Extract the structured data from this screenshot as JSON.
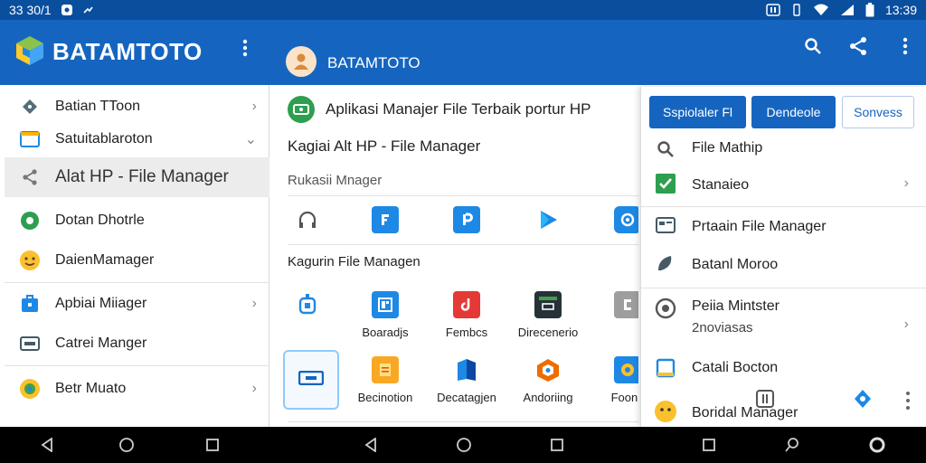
{
  "status_bar": {
    "time_left": "33 30/1",
    "time_right": "13:39"
  },
  "app_bar": {
    "title": "BATAMTOTO",
    "subtitle_title": "BATAMTOTO"
  },
  "drawer": {
    "items": [
      {
        "label": "Batian TToon",
        "icon": "diamond-tag-icon",
        "chevron": "›"
      },
      {
        "label": "Satuitablaroton",
        "icon": "calendar-window-icon",
        "chevron": "⌄"
      },
      {
        "label": "Alat HP - File Manager",
        "icon": "share-icon",
        "chevron": ""
      },
      {
        "label": "Dotan Dhotrle",
        "icon": "green-circle-icon",
        "chevron": ""
      },
      {
        "label": "DaienMamager",
        "icon": "smiley-icon",
        "chevron": ""
      },
      {
        "label": "Apbiai Miiager",
        "icon": "briefcase-icon",
        "chevron": "›"
      },
      {
        "label": "Catrei Manger",
        "icon": "card-icon",
        "chevron": ""
      },
      {
        "label": "Betr Muato",
        "icon": "globe-icon",
        "chevron": "›"
      }
    ]
  },
  "main": {
    "heading": "Aplikasi Manajer File Terbaik portur HP",
    "subtitle": "Kagiai Alt HP - File Manager",
    "section1": "Rukasii Mnager",
    "section2": "Kagurin File Managen",
    "row2_labels": [
      "Boaradjs",
      "Fembcs",
      "Direcenerio"
    ],
    "row3_labels": [
      "Becinotion",
      "Decatagjen",
      "Andoriing",
      "Foonu"
    ]
  },
  "panel": {
    "buttons": [
      "Sspiolaler Fl",
      "Dendeole",
      "Sonvess"
    ],
    "items": [
      {
        "label": "File Mathip",
        "sub": ""
      },
      {
        "label": "Stanaieo",
        "sub": ""
      },
      {
        "label": "Prtaain File Manager",
        "sub": ""
      },
      {
        "label": "Batanl Moroo",
        "sub": ""
      },
      {
        "label": "Peiia Mintster",
        "sub": "2noviasas"
      },
      {
        "label": "Catali Bocton",
        "sub": ""
      },
      {
        "label": "Boridal Manager",
        "sub": ""
      }
    ]
  },
  "colors": {
    "brand": "#1565c0",
    "status": "#0a4f9e",
    "accent_green": "#2e9e4f"
  }
}
